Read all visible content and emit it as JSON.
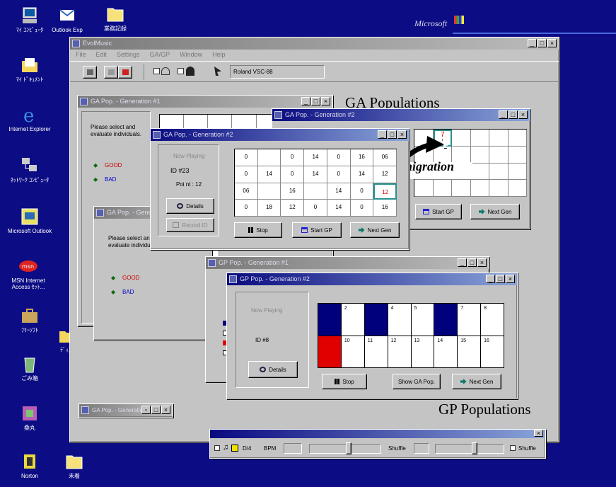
{
  "desktop": {
    "icons": [
      {
        "label": "ﾏｲ ｺﾝﾋﾟｭｰﾀ",
        "icon": "my-computer-icon"
      },
      {
        "label": "ﾏｲ ﾄﾞｷｭﾒﾝﾄ",
        "icon": "my-documents-icon"
      },
      {
        "label": "Internet Explorer",
        "icon": "internet-explorer-icon"
      },
      {
        "label": "ﾈｯﾄﾜｰｸ ｺﾝﾋﾟｭｰﾀ",
        "icon": "network-icon"
      },
      {
        "label": "Microsoft Outlook",
        "icon": "outlook-icon"
      },
      {
        "label": "MSN Internet Access ｾｯﾄ...",
        "icon": "msn-icon"
      },
      {
        "label": "ﾌﾘｰｿﾌﾄ",
        "icon": "briefcase-icon"
      },
      {
        "label": "ごみ箱",
        "icon": "recycle-bin-icon"
      },
      {
        "label": "桑丸",
        "icon": "app-icon"
      },
      {
        "label": "Norton",
        "icon": "norton-icon"
      }
    ],
    "col2": [
      {
        "label": "Outlook Exp",
        "icon": "outlook-express-icon"
      },
      {
        "label": "ﾃﾞｨｽｸ",
        "icon": "folder-icon"
      }
    ],
    "top_folder": "業務記録",
    "bottom_folder": "未着",
    "ms_logo": "Microsoft"
  },
  "main": {
    "title": "EvolMusic",
    "menu": [
      "File",
      "Edit",
      "Settings",
      "GA/GP",
      "Window",
      "Help"
    ],
    "synth": "Roland VSC-88"
  },
  "labels": {
    "ga": "GA Populations",
    "gp": "GP Populations",
    "migration": "migration"
  },
  "ga_common": {
    "title": "GA Pop. - Generation #1",
    "good": "GOOD",
    "bad": "BAD"
  },
  "ga_back": {
    "title": "GA Pop. - Generation #1",
    "prompt": "Please select and evaluate individuals.",
    "good": "GOOD",
    "bad": "BAD"
  },
  "ga_front": {
    "title": "GA Pop. - Generation #2",
    "now_playing": "Now Playing",
    "id": "ID #23",
    "point": "Poi nt : 12",
    "details": "Details",
    "record": "Record ID",
    "stop": "Stop",
    "start": "Start GP",
    "next": "Next Gen",
    "cells": [
      [
        "0",
        "",
        "0",
        "14",
        "0",
        "16",
        "06"
      ],
      [
        "0",
        "14",
        "0",
        "14",
        "0",
        "14",
        "12"
      ],
      [
        "06",
        "",
        "16",
        "",
        "14",
        "0",
        ""
      ],
      [
        "0",
        "18",
        "12",
        "0",
        "14",
        "0",
        "16"
      ]
    ],
    "selected": "12"
  },
  "ga_right": {
    "title": "GA Pop. - Generation #2",
    "start": "Start GP",
    "next": "Next Gen"
  },
  "ga_mini": {
    "title": "GA Pop. - Generation #1"
  },
  "gp_back": {
    "title": "GP Pop. - Generation #1"
  },
  "gp_front": {
    "title": "GP Pop. - Generation #2",
    "now_playing": "Now Playing",
    "id": "ID #8",
    "details": "Details",
    "stop": "Stop",
    "show": "Show GA Pop.",
    "next": "Next Gen",
    "top": [
      "",
      "2",
      "",
      "4",
      "5",
      "",
      "7",
      "8"
    ],
    "bottom": [
      "",
      "10",
      "11",
      "12",
      "13",
      "14",
      "15",
      "16"
    ]
  },
  "toolbar": {
    "ratio": "D/4",
    "bpm": "BPM",
    "shuffle": "Shuffle",
    "shuffle2": "Shuffle"
  },
  "colors": {
    "desktop": "#0c0c84",
    "title_active": "#0a0a80",
    "blue_cell": "#00007c",
    "red_cell": "#e00000"
  }
}
